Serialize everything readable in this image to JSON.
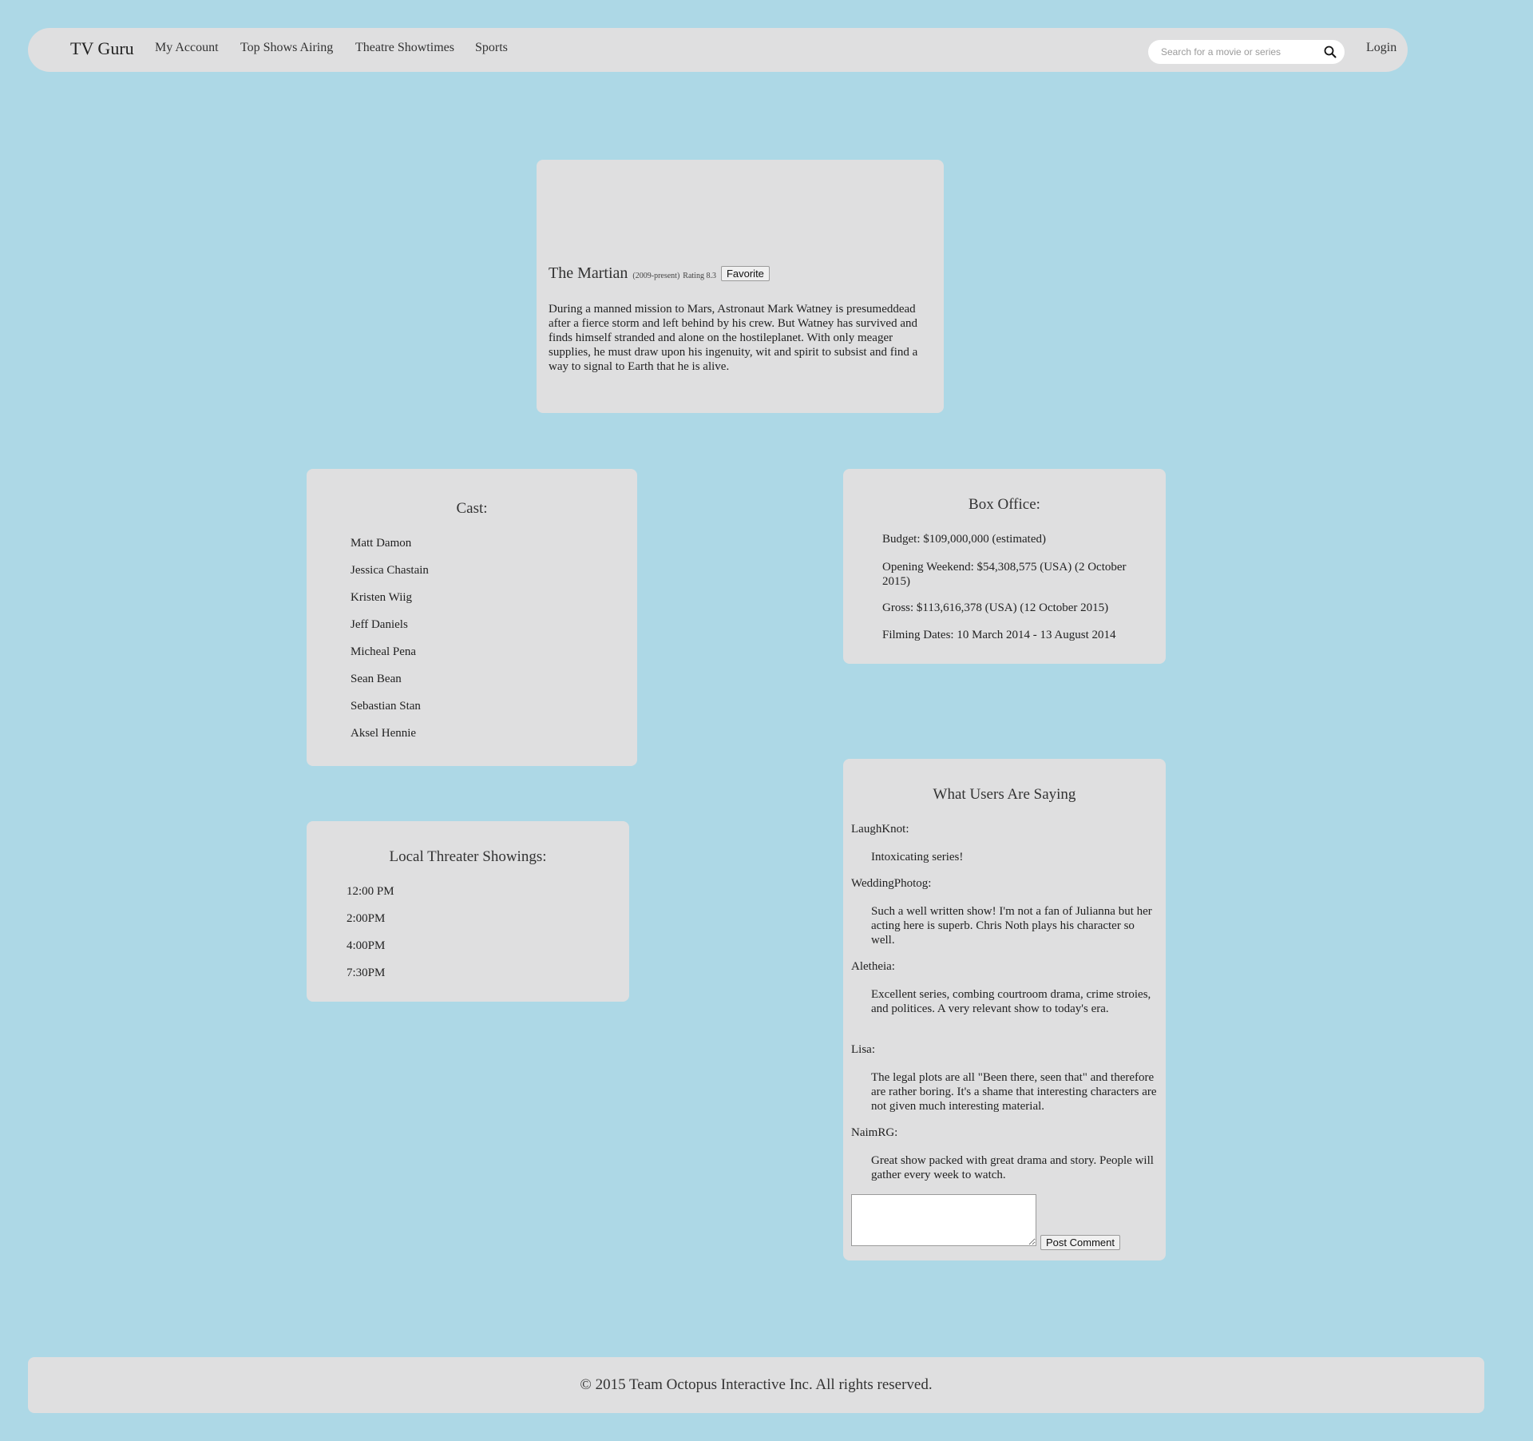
{
  "nav": {
    "brand": "TV Guru",
    "links": [
      "My Account",
      "Top Shows Airing",
      "Theatre Showtimes",
      "Sports"
    ],
    "search_placeholder": "Search for a movie or series",
    "search_icon": "search-icon",
    "login": "Login"
  },
  "movie": {
    "title": "The Martian",
    "years": "(2009-present)",
    "rating_text": "Rating 8.3",
    "favorite_label": "Favorite",
    "description": "During a manned mission to Mars, Astronaut Mark Watney is presumeddead after a fierce storm and left behind by his crew. But Watney has survived and finds himself stranded and alone on the hostileplanet. With only meager supplies, he must draw upon his ingenuity, wit and spirit to subsist and find a way to signal to Earth that he is alive."
  },
  "cast": {
    "heading": "Cast:",
    "members": [
      "Matt Damon",
      "Jessica Chastain",
      "Kristen Wiig",
      "Jeff Daniels",
      "Micheal Pena",
      "Sean Bean",
      "Sebastian Stan",
      "Aksel Hennie"
    ]
  },
  "box_office": {
    "heading": "Box Office:",
    "items": [
      "Budget: $109,000,000 (estimated)",
      "Opening Weekend: $54,308,575 (USA) (2 October 2015)",
      "Gross: $113,616,378 (USA) (12 October 2015)",
      "Filming Dates: 10 March 2014 - 13 August 2014"
    ]
  },
  "showings": {
    "heading": "Local Threater Showings:",
    "times": [
      "12:00 PM",
      "2:00PM",
      "4:00PM",
      "7:30PM"
    ]
  },
  "reviews": {
    "heading": "What Users Are Saying",
    "items": [
      {
        "user": "LaughKnot:",
        "text": "Intoxicating series!"
      },
      {
        "user": "WeddingPhotog:",
        "text": "Such a well written show! I'm not a fan of Julianna but her acting here is superb. Chris Noth plays his character so well."
      },
      {
        "user": "Aletheia:",
        "text": "Excellent series, combing courtroom drama, crime stroies, and politices. A very relevant show to today's era."
      },
      {
        "user": "Lisa:",
        "text": "The legal plots are all \"Been there, seen that\" and therefore are rather boring. It's a shame that interesting characters are not given much interesting material."
      },
      {
        "user": "NaimRG:",
        "text": "Great show packed with great drama and story. People will gather every week to watch."
      }
    ],
    "comment_value": "",
    "post_label": "Post Comment"
  },
  "footer": {
    "text": "© 2015 Team Octopus Interactive Inc. All rights reserved."
  }
}
